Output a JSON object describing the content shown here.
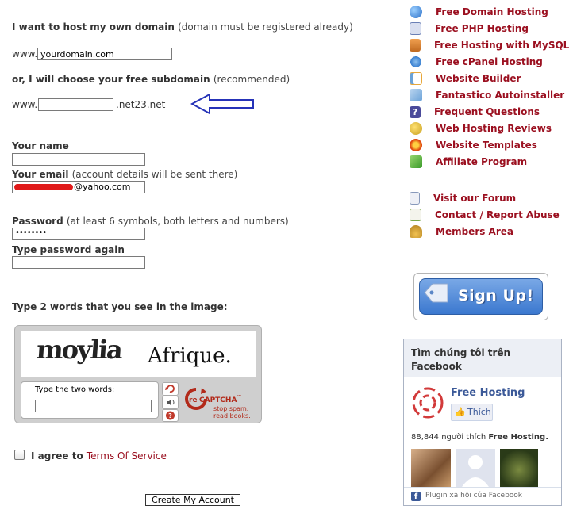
{
  "form": {
    "host_own_title": "I want to host my own domain",
    "host_own_note": "(domain must be registered already)",
    "www_prefix_1": "www.",
    "domain_value": "yourdomain.com",
    "free_sub_title": "or, I will choose your free subdomain",
    "free_sub_note": "(recommended)",
    "www_prefix_2": "www.",
    "subdomain_value": "",
    "subdomain_suffix": ".net23.net",
    "name_label": "Your name",
    "name_value": "",
    "email_label": "Your email",
    "email_note": "(account details will be sent there)",
    "email_value": "@yahoo.com",
    "password_label": "Password",
    "password_note": "(at least 6 symbols, both letters and numbers)",
    "password_value": "••••••••",
    "password2_label": "Type password again",
    "password2_value": "",
    "captcha_prompt": "Type 2 words that you see in the image:",
    "agree_text": "I agree to",
    "tos_link": "Terms Of Service",
    "submit_label": "Create My Account"
  },
  "captcha": {
    "word1": "moylia",
    "word2": "Afrique.",
    "input_label": "Type the two words:",
    "logo_re": "re",
    "logo_captcha": "CAPTCHA",
    "logo_tm": "™",
    "slogan1": "stop spam.",
    "slogan2": "read books."
  },
  "menu": {
    "items": [
      {
        "label": "Free Domain Hosting",
        "icon": "globe-icon",
        "color": "#3a7bd5"
      },
      {
        "label": "Free PHP Hosting",
        "icon": "php-icon",
        "color": "#6a7fb5"
      },
      {
        "label": "Free Hosting with MySQL",
        "icon": "database-icon",
        "color": "#d07b2a"
      },
      {
        "label": "Free cPanel Hosting",
        "icon": "cpanel-icon",
        "color": "#4a90d9"
      },
      {
        "label": "Website Builder",
        "icon": "builder-icon",
        "color": "#e8a73a"
      },
      {
        "label": "Fantastico Autoinstaller",
        "icon": "installer-icon",
        "color": "#6aa2d8"
      },
      {
        "label": "Frequent Questions",
        "icon": "question-icon",
        "color": "#5a5aa8"
      },
      {
        "label": "Web Hosting Reviews",
        "icon": "reviews-icon",
        "color": "#c8a020"
      },
      {
        "label": "Website Templates",
        "icon": "templates-icon",
        "color": "#d84a1a"
      },
      {
        "label": "Affiliate Program",
        "icon": "affiliate-icon",
        "color": "#5aa83a"
      }
    ],
    "items2": [
      {
        "label": "Visit our Forum",
        "icon": "forum-icon",
        "color": "#8899bb"
      },
      {
        "label": "Contact / Report Abuse",
        "icon": "contact-icon",
        "color": "#7aa84a"
      },
      {
        "label": "Members Area",
        "icon": "members-icon",
        "color": "#d8a83a"
      }
    ]
  },
  "signup": {
    "label": "Sign Up!"
  },
  "facebook": {
    "header": "Tìm chúng tôi trên Facebook",
    "page_name": "Free Hosting",
    "like_label": "Thích",
    "likes_count": "88,844",
    "likes_text": "người thích",
    "likes_page": "Free Hosting.",
    "plugin_text": "Plugin xã hội của Facebook"
  }
}
